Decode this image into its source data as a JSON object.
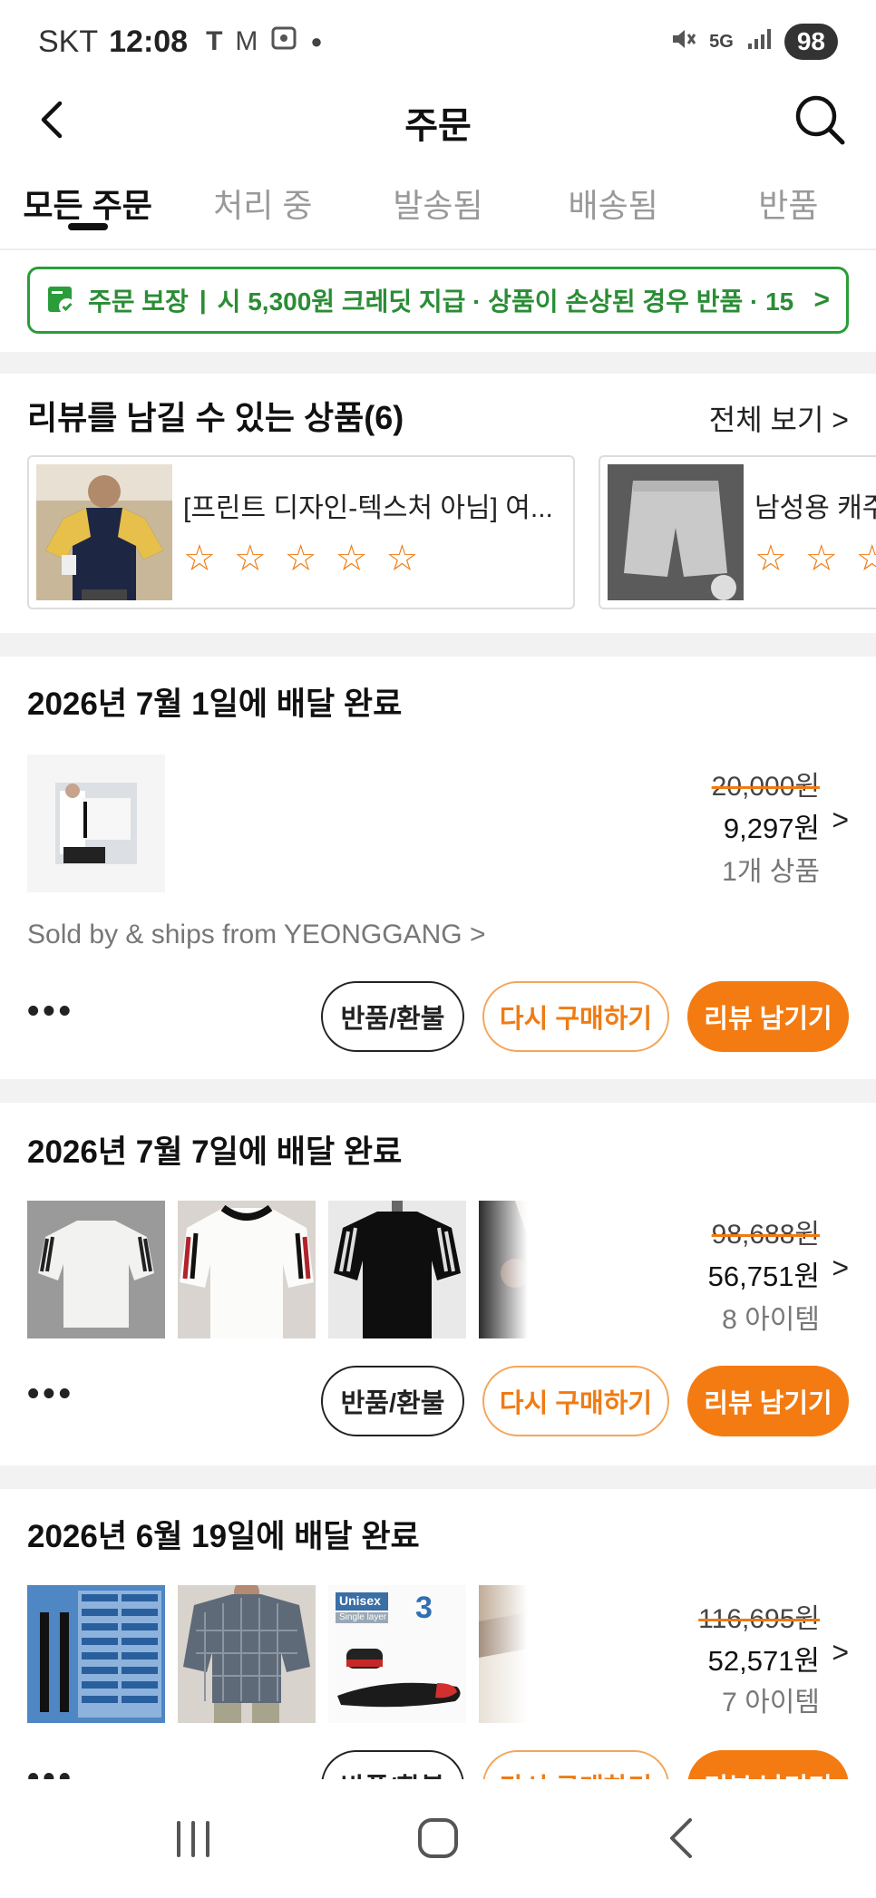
{
  "status_bar": {
    "carrier": "SKT",
    "time": "12:08",
    "left_icons": [
      "T",
      "M"
    ],
    "battery": "98"
  },
  "header": {
    "title": "주문"
  },
  "tabs": [
    {
      "label": "모든 주문",
      "active": true
    },
    {
      "label": "처리 중",
      "active": false
    },
    {
      "label": "발송됨",
      "active": false
    },
    {
      "label": "배송됨",
      "active": false
    },
    {
      "label": "반품",
      "active": false
    }
  ],
  "guarantee": {
    "title": "주문 보장",
    "separator": "|",
    "text": "시 5,300원 크레딧 지급 · 상품이 손상된 경우 반품 · 15",
    "color": "#2a8d35"
  },
  "review_section": {
    "title": "리뷰를 남길 수 있는 상품(6)",
    "view_all": "전체 보기 >",
    "items": [
      {
        "name": "[프린트 디자인-텍스처 아님] 여...",
        "stars": 5
      },
      {
        "name": "남성용 캐주",
        "stars": 5
      }
    ]
  },
  "orders": [
    {
      "date": "2026년 7월 1일에 배달 완료",
      "original_price": "20,000원",
      "price": "9,297원",
      "count": "1개 상품",
      "seller": "Sold by & ships from YEONGGANG >"
    },
    {
      "date": "2026년 7월 7일에 배달 완료",
      "original_price": "98,688원",
      "price": "56,751원",
      "count": "8 아이템"
    },
    {
      "date": "2026년 6월 19일에 배달 완료",
      "original_price": "116,695원",
      "price": "52,571원",
      "count": "7 아이템",
      "thumb_text": [
        "Unisex",
        "Single layer",
        "3"
      ]
    }
  ],
  "actions": {
    "more": "•••",
    "return": "반품/환불",
    "rebuy": "다시 구매하기",
    "review": "리뷰 남기기"
  },
  "colors": {
    "accent": "#f47b12",
    "guarantee_green": "#2a9d3a"
  }
}
